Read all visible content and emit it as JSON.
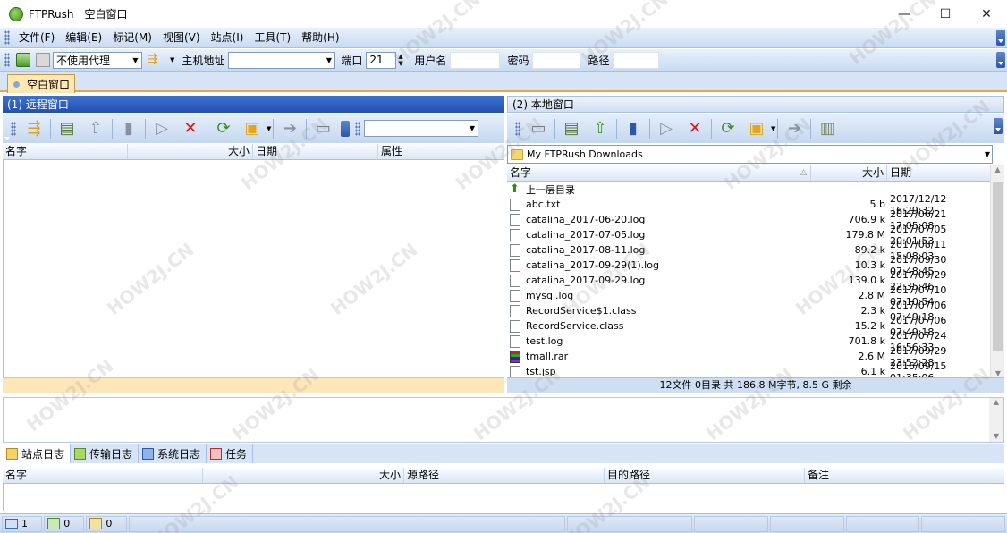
{
  "app": {
    "name": "FTPRush",
    "window_title": "空白窗口"
  },
  "window_controls": {
    "minimize": "—",
    "maximize": "☐",
    "close": "✕"
  },
  "menu": [
    "文件(F)",
    "编辑(E)",
    "标记(M)",
    "视图(V)",
    "站点(I)",
    "工具(T)",
    "帮助(H)"
  ],
  "connection": {
    "proxy": "不使用代理",
    "host_label": "主机地址",
    "host_value": "",
    "port_label": "端口",
    "port_value": "21",
    "user_label": "用户名",
    "user_value": "",
    "password_label": "密码",
    "password_value": "",
    "path_label": "路径",
    "path_value": ""
  },
  "tab": {
    "label": "空白窗口"
  },
  "remote": {
    "title": "(1) 远程窗口",
    "columns": [
      "名字",
      "大小",
      "日期",
      "属性"
    ]
  },
  "local": {
    "title": "(2) 本地窗口",
    "path": "My FTPRush Downloads",
    "columns": [
      "名字",
      "大小",
      "日期"
    ],
    "sort_indicator": "△",
    "files": [
      {
        "name": "上一层目录",
        "size": "",
        "date": "",
        "type": "up"
      },
      {
        "name": "abc.txt",
        "size": "5 b",
        "date": "2017/12/12 16:29:32",
        "type": "file"
      },
      {
        "name": "catalina_2017-06-20.log",
        "size": "706.9 k",
        "date": "2017/06/21 17:05:08",
        "type": "file"
      },
      {
        "name": "catalina_2017-07-05.log",
        "size": "179.8 M",
        "date": "2017/07/05 20:01:53",
        "type": "file"
      },
      {
        "name": "catalina_2017-08-11.log",
        "size": "89.2 k",
        "date": "2017/08/11 15:08:03",
        "type": "file"
      },
      {
        "name": "catalina_2017-09-29(1).log",
        "size": "10.3 k",
        "date": "2017/09/30 07:48:45",
        "type": "file"
      },
      {
        "name": "catalina_2017-09-29.log",
        "size": "139.0 k",
        "date": "2017/09/29 22:35:46",
        "type": "file"
      },
      {
        "name": "mysql.log",
        "size": "2.8 M",
        "date": "2017/07/10 07:10:54",
        "type": "file"
      },
      {
        "name": "RecordService$1.class",
        "size": "2.3 k",
        "date": "2017/07/06 07:49:18",
        "type": "file"
      },
      {
        "name": "RecordService.class",
        "size": "15.2 k",
        "date": "2017/07/06 07:49:18",
        "type": "file"
      },
      {
        "name": "test.log",
        "size": "701.8 k",
        "date": "2017/07/24 16:56:33",
        "type": "file"
      },
      {
        "name": "tmall.rar",
        "size": "2.6 M",
        "date": "2017/09/29 23:52:28",
        "type": "rar"
      },
      {
        "name": "tst.jsp",
        "size": "6.1 k",
        "date": "2016/09/15 01:35:06",
        "type": "file"
      }
    ],
    "status": "12文件 0目录 共 186.8 M字节, 8.5 G 剩余"
  },
  "log_tabs": [
    "站点日志",
    "传输日志",
    "系统日志",
    "任务"
  ],
  "task_columns": [
    "名字",
    "大小",
    "源路径",
    "目的路径",
    "备注"
  ],
  "statusbar": {
    "connections": "1",
    "uploads": "0",
    "downloads": "0"
  },
  "watermark": "HOW2J.CN"
}
